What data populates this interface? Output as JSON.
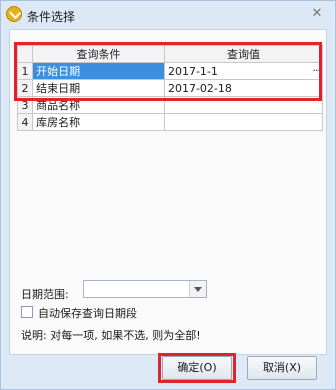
{
  "window": {
    "title": "条件选择"
  },
  "grid": {
    "headers": {
      "condition": "查询条件",
      "value": "查询值"
    },
    "rows": [
      {
        "num": "1",
        "condition": "开始日期",
        "value": "2017-1-1"
      },
      {
        "num": "2",
        "condition": "结束日期",
        "value": "2017-02-18"
      },
      {
        "num": "3",
        "condition": "商品名称",
        "value": ""
      },
      {
        "num": "4",
        "condition": "库房名称",
        "value": ""
      }
    ],
    "ellipsis": "···"
  },
  "date_range": {
    "label": "日期范围:",
    "value": ""
  },
  "auto_save": {
    "label": "自动保存查询日期段",
    "checked": false
  },
  "note": "说明: 对每一项, 如果不选, 则为全部!",
  "buttons": {
    "ok": "确定(O)",
    "cancel": "取消(X)"
  }
}
